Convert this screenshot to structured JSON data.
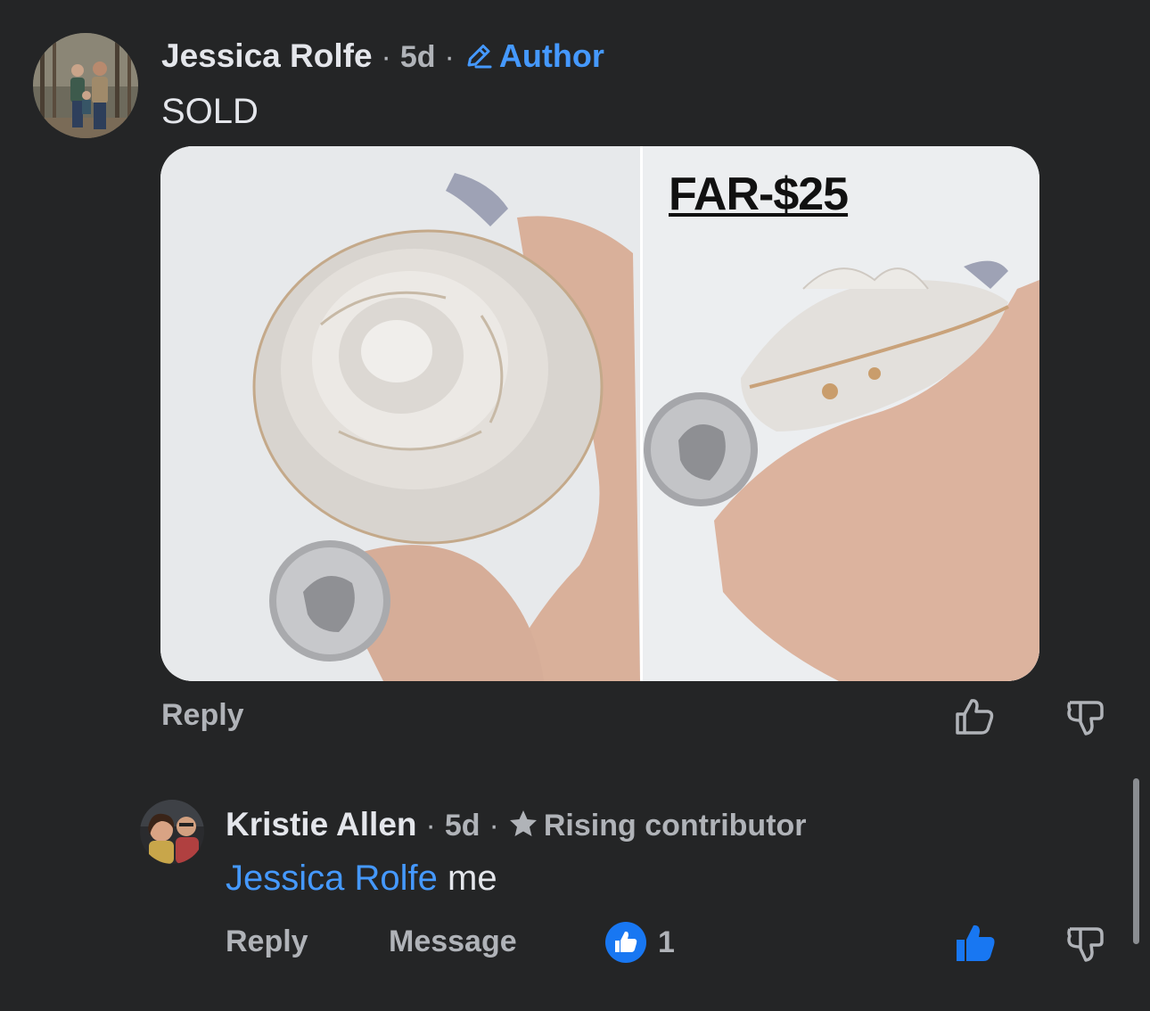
{
  "comment": {
    "author_name": "Jessica Rolfe",
    "time": "5d",
    "badge": "Author",
    "badge_icon": "pencil-icon",
    "text": "SOLD",
    "photo_caption": "FAR-$25",
    "reply_label": "Reply"
  },
  "reply_comment": {
    "author_name": "Kristie Allen",
    "time": "5d",
    "badge": "Rising contributor",
    "badge_icon": "star-icon",
    "mention": "Jessica Rolfe",
    "text": "me",
    "reply_label": "Reply",
    "message_label": "Message",
    "reaction_count": "1"
  },
  "separator": "·",
  "colors": {
    "background": "#242526",
    "primary_text": "#e4e6eb",
    "secondary_text": "#b0b3b8",
    "accent_blue": "#4599ff",
    "like_blue": "#1877f2"
  }
}
